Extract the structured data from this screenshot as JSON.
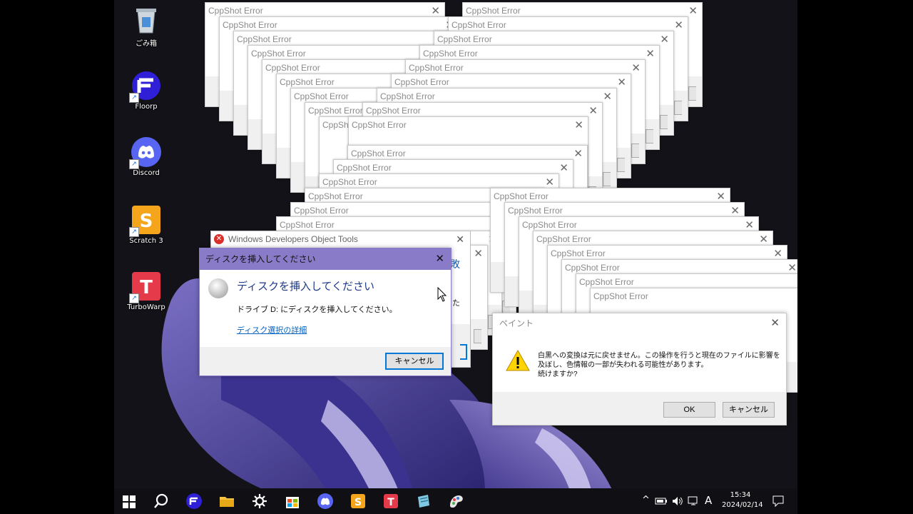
{
  "desktop_icons": [
    {
      "name": "recycle-bin-icon",
      "label": "ごみ箱"
    },
    {
      "name": "floorp-icon",
      "label": "Floorp"
    },
    {
      "name": "discord-icon",
      "label": "Discord"
    },
    {
      "name": "scratch-icon",
      "label": "Scratch 3"
    },
    {
      "name": "turbowarp-icon",
      "label": "TurboWarp"
    }
  ],
  "cppshot": {
    "title": "CppShot Error",
    "close": "✕"
  },
  "wdot": {
    "title": "Windows Developers Object Tools",
    "close": "✕",
    "edge_text_1": "敗",
    "edge_text_2": "った"
  },
  "disk_dialog": {
    "title": "ディスクを挿入してください",
    "close": "✕",
    "heading": "ディスクを挿入してください",
    "message": "ドライブ D: にディスクを挿入してください。",
    "link": "ディスク選択の詳細",
    "cancel": "キャンセル"
  },
  "paint_dialog": {
    "title": "ペイント",
    "close": "✕",
    "message_line1": "白黒への変換は元に戻せません。この操作を行うと現在のファイルに影響を",
    "message_line2": "及ぼし、色情報の一部が失われる可能性があります。",
    "message_line3": "続けますか?",
    "ok": "OK",
    "cancel": "キャンセル"
  },
  "taskbar": {
    "apps": [
      "start-icon",
      "search-icon",
      "floorp-icon",
      "file-explorer-icon",
      "settings-icon",
      "store-icon",
      "discord-icon",
      "scratch-icon",
      "turbowarp-icon",
      "notepad-icon",
      "paint-icon"
    ],
    "tray": {
      "chevron": "^",
      "ime": "A",
      "time": "15:34",
      "date": "2024/02/14"
    }
  },
  "colors": {
    "disk_titlebar": "#8a7bc9",
    "error_red": "#d9302b",
    "link": "#0563c1",
    "wallpaper_purple": "#5b4fa0"
  }
}
